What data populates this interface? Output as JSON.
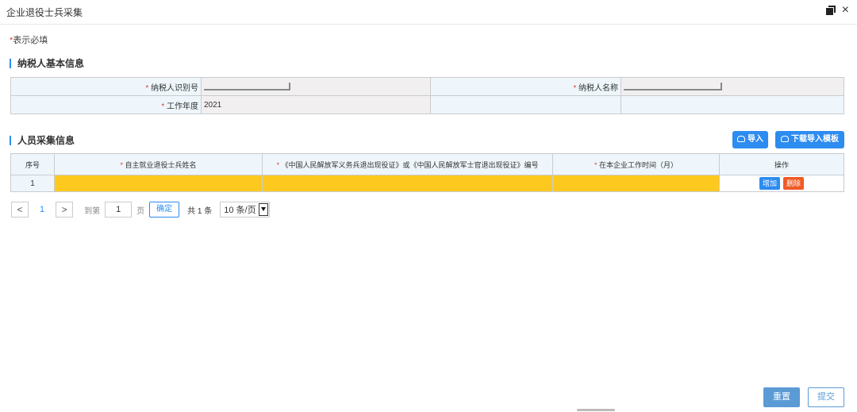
{
  "window": {
    "title": "企业退役士兵采集",
    "icons": [
      "restore-icon",
      "close-icon"
    ],
    "close_symbol": "×"
  },
  "required_note": {
    "star": "*",
    "text": "表示必填"
  },
  "basic_info": {
    "title": "纳税人基本信息",
    "fields": {
      "taxpayer_id_label": "纳税人识别号",
      "taxpayer_name_label": "纳税人名称",
      "work_year_label": "工作年度",
      "work_year_value": "2021"
    }
  },
  "personnel": {
    "title": "人员采集信息",
    "import_label": "导入",
    "download_template_label": "下载导入模板",
    "columns": {
      "index": "序号",
      "name": "自主就业退役士兵姓名",
      "certificate": "《中国人民解放军义务兵退出现役证》或《中国人民解放军士官退出现役证》编号",
      "work_months": "在本企业工作时间（月）",
      "actions": "操作"
    },
    "rows": [
      {
        "index": "1",
        "name": "",
        "certificate": "",
        "work_months": ""
      }
    ],
    "add_label": "增加",
    "delete_label": "删除"
  },
  "pagination": {
    "prev_symbol": "<",
    "current_page": "1",
    "next_symbol": ">",
    "goto_label": "到第",
    "goto_value": "1",
    "page_unit": "页",
    "confirm_label": "确定",
    "total_label": "共 1 条",
    "page_size": "10 条/页"
  },
  "footer": {
    "reset_label": "重置",
    "submit_label": "提交"
  },
  "colors": {
    "accent": "#2d8cf0",
    "required_cell": "#fec91f",
    "delete": "#f15a24",
    "required_star": "#e23b3b"
  }
}
